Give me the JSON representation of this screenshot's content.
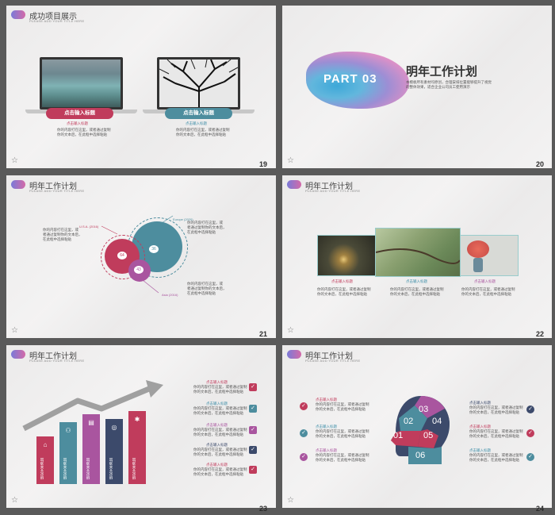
{
  "s19": {
    "title": "成功项目展示",
    "subtitle": "PLEASE ADD YOUR TITLE HERE",
    "num": "19",
    "card1_btn": "点击输入标题",
    "card1_sub": "点击输入标题",
    "card1_desc1": "你的内容打在这里，或者通过复制",
    "card1_desc2": "你的文本后，在此框中选择粘贴",
    "card2_btn": "点击输入标题",
    "card2_sub": "点击输入标题",
    "card2_desc1": "你的内容打在这里，或者通过复制",
    "card2_desc2": "你的文本后，在此框中选择粘贴"
  },
  "s20": {
    "part": "PART 03",
    "heading": "明年工作计划",
    "body": "本模板所有素材均原创，合理安排位置能够提升了视觉的整体效果，适合企业公司员工使用演示",
    "num": "20"
  },
  "s21": {
    "title": "明年工作计划",
    "subtitle": "PLEASE ADD YOUR TITLE HERE",
    "num": "21",
    "c1": "64",
    "c2": "36",
    "c3": "43",
    "lab_usa": "U.S.A. (2016)",
    "lab_europe": "Europe (2020)",
    "lab_asia": "Asia (2016)",
    "t1a": "你的内容打在这里，或",
    "t1b": "者通过复制你的文本后，",
    "t1c": "在此框中选择粘贴",
    "t2a": "你的内容打在这里，或",
    "t2b": "者通过复制你的文本后，",
    "t2c": "在此框中选择粘贴",
    "t3a": "你的内容打在这里，或",
    "t3b": "者通过复制你的文本后，",
    "t3c": "在此框中选择粘贴"
  },
  "s22": {
    "num": "22",
    "cap1": "点击输入标题",
    "cap2": "点击输入标题",
    "cap3": "点击输入标题",
    "d1a": "你的内容打在这里，或者通过复制",
    "d1b": "你的文本后，在此框中选择粘贴",
    "d2a": "你的内容打在这里，或者通过复制",
    "d2b": "你的文本后，在此框中选择粘贴",
    "d3a": "你的内容打在这里，或者通过复制",
    "d3b": "你的文本后，在此框中选择粘贴"
  },
  "s23": {
    "title": "明年工作计划",
    "subtitle": "PLEASE ADD YOUR TITLE HERE",
    "num": "23",
    "bars": [
      "研究文本添加",
      "研究文本添加",
      "研究文本添加",
      "研究文本添加",
      "研究文本添加"
    ],
    "items": [
      "点击输入标题",
      "点击输入标题",
      "点击输入标题",
      "点击输入标题",
      "点击输入标题"
    ],
    "desc1": "你的内容打在这里，或者通过复制",
    "desc2": "你的文本后，在此框中选择粘贴"
  },
  "s24": {
    "title": "明年工作计划",
    "subtitle": "PLEASE ADD YOUR TITLE HERE",
    "num": "24",
    "item": "点击输入标题",
    "d1": "你的内容打在这里，或者通过复制",
    "d2": "你的文本后，在此框中选择粘贴",
    "p1": "01",
    "p2": "02",
    "p3": "03",
    "p4": "04",
    "p5": "05",
    "p6": "06"
  },
  "colors": {
    "pink": "#c03c5c",
    "teal": "#3e8ea8",
    "purple": "#a9559f",
    "navy": "#3c4a6b"
  }
}
